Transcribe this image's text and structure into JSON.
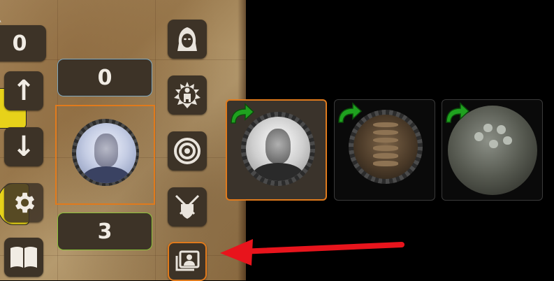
{
  "board": {
    "counter_top": "0",
    "arrow_up_label": "↑",
    "arrow_down_label": "↓",
    "settings_icon": "gear-icon",
    "manual_icon": "book-icon"
  },
  "selected_unit": {
    "top_value": "0",
    "bottom_value": "3",
    "portrait": "portrait-grayscale-man"
  },
  "tools": [
    {
      "icon": "hooded-figure-icon"
    },
    {
      "icon": "aura-figure-icon"
    },
    {
      "icon": "target-icon"
    },
    {
      "icon": "crossed-swords-shield-icon"
    },
    {
      "icon": "card-gallery-icon",
      "active": true
    }
  ],
  "roster": [
    {
      "portrait": "portrait-bw-man",
      "selected": true,
      "badge": "green-redo-arrow"
    },
    {
      "portrait": "portrait-insect-creature",
      "selected": false,
      "badge": "green-redo-arrow"
    },
    {
      "portrait": "portrait-mechanical-creature",
      "selected": false,
      "badge": "green-redo-arrow"
    }
  ],
  "colors": {
    "accent_orange": "#e07a1c",
    "box_blue_border": "#7fa7bd",
    "box_green_border": "#8cc23a",
    "tile_dark": "#3d3327",
    "annotation_red": "#e8141c",
    "badge_green": "#1fa11f"
  }
}
